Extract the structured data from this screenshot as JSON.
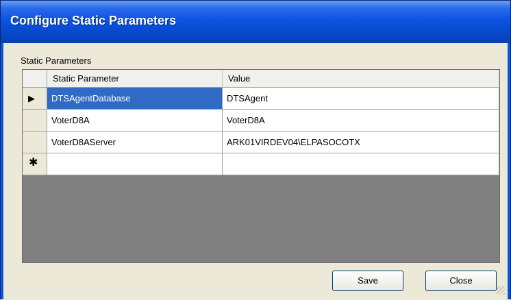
{
  "window": {
    "title": "Configure Static Parameters"
  },
  "group": {
    "label": "Static Parameters"
  },
  "grid": {
    "headers": [
      "Static Parameter",
      "Value"
    ],
    "rows": [
      {
        "name": "DTSAgentDatabase",
        "value": "DTSAgent",
        "indicator": "current",
        "selected": true
      },
      {
        "name": "VoterD8A",
        "value": "VoterD8A",
        "indicator": "",
        "selected": false
      },
      {
        "name": "VoterD8AServer",
        "value": "ARK01VIRDEV04\\ELPASOCOTX",
        "indicator": "",
        "selected": false
      },
      {
        "name": "",
        "value": "",
        "indicator": "new",
        "selected": false
      }
    ],
    "icons": {
      "current_row": "row-arrow-icon",
      "new_row": "new-row-star-icon"
    }
  },
  "buttons": {
    "save": "Save",
    "close": "Close"
  },
  "colors": {
    "title_bar": "#0a54e2",
    "selection": "#316ac5",
    "grid_background": "#808080"
  }
}
